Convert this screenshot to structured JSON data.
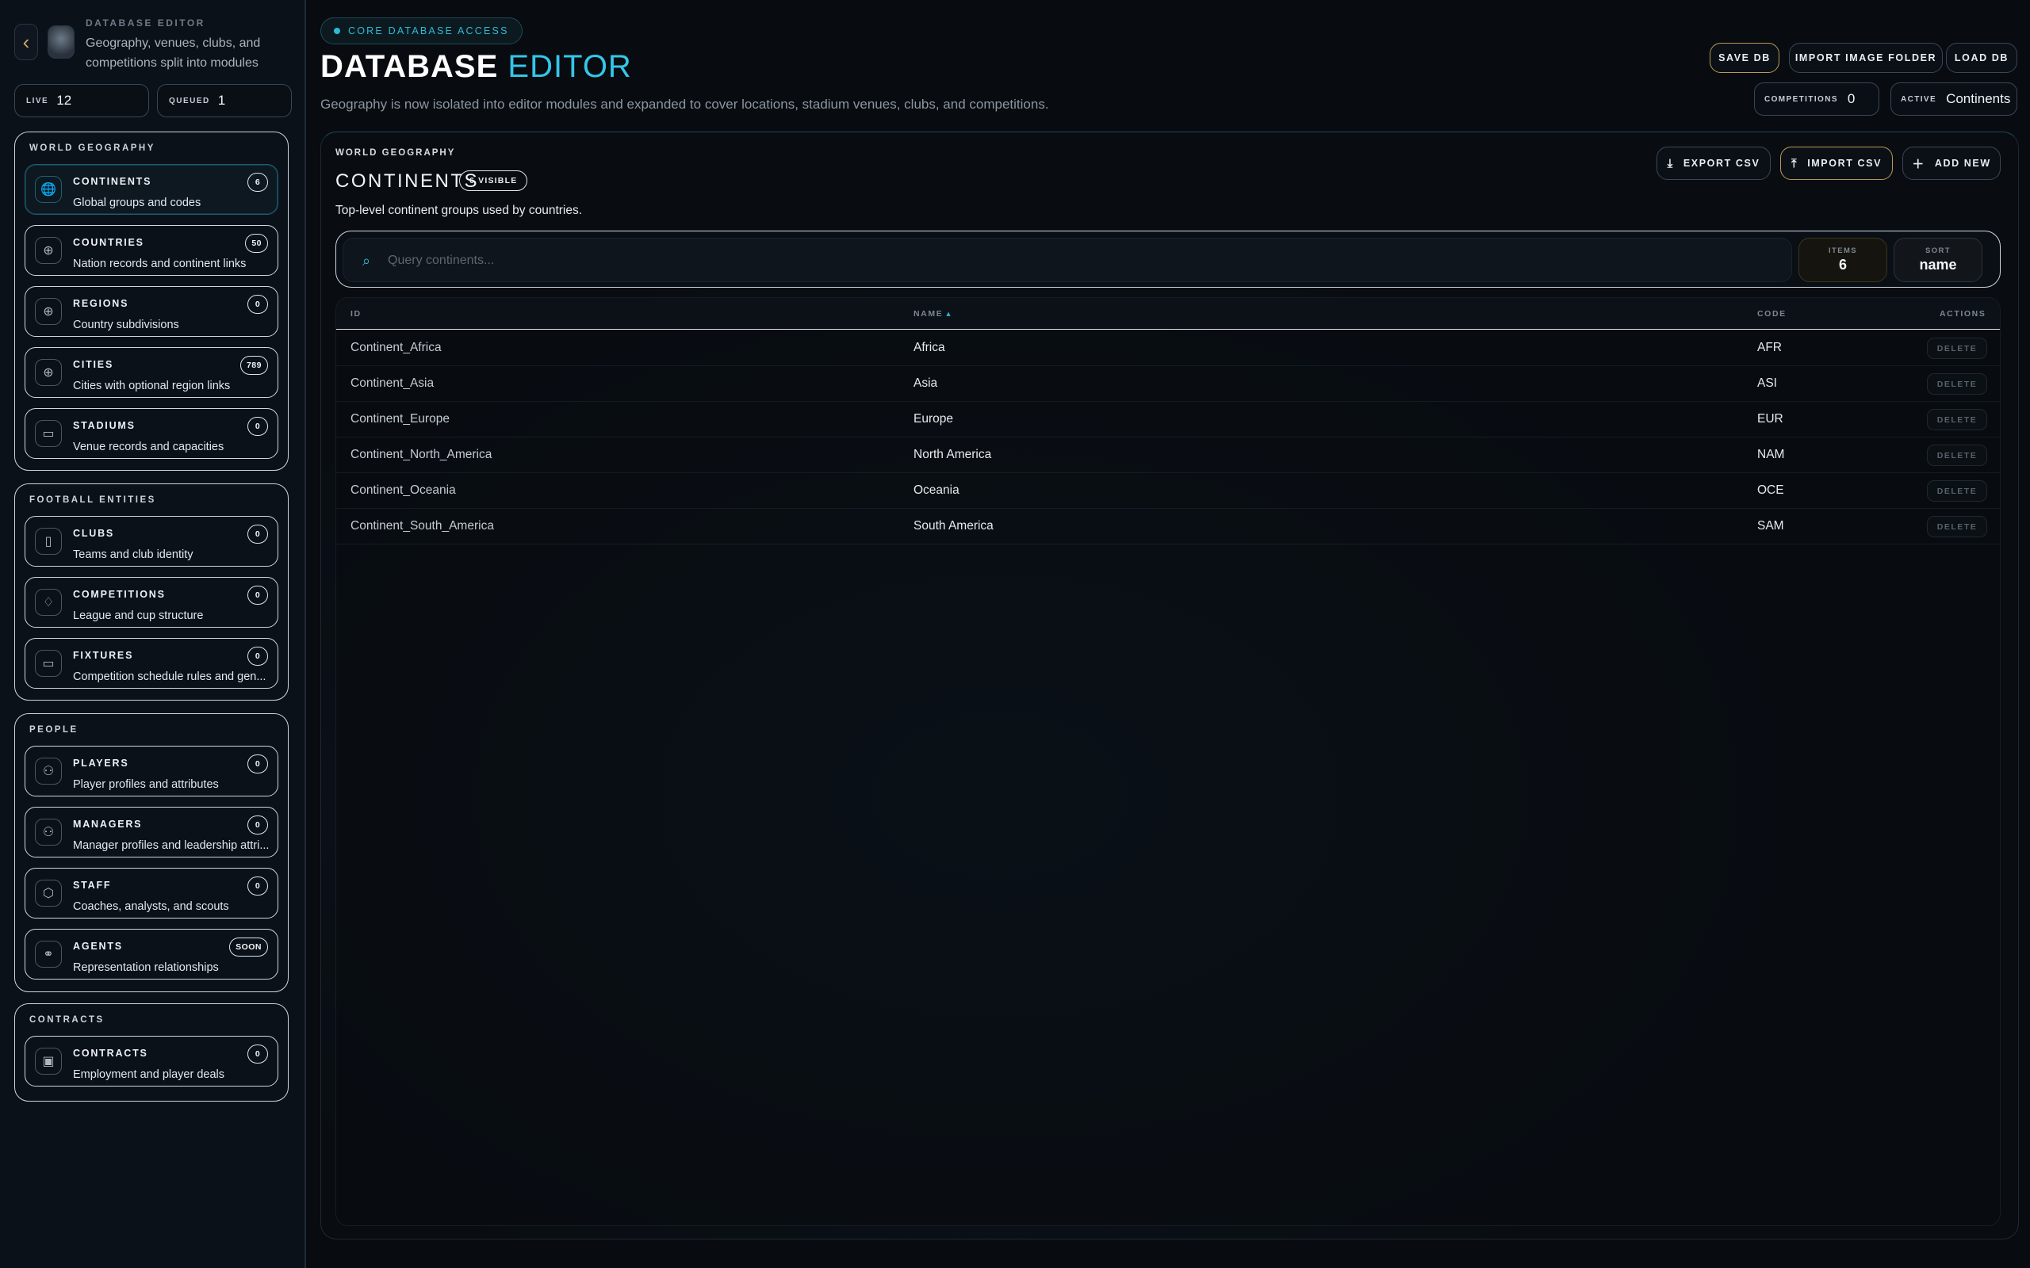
{
  "sidebar": {
    "eyebrow": "DATABASE EDITOR",
    "description": "Geography, venues, clubs, and competitions split into modules",
    "live": {
      "label": "LIVE",
      "value": "12"
    },
    "queued": {
      "label": "QUEUED",
      "value": "1"
    },
    "groups": [
      {
        "title": "WORLD GEOGRAPHY",
        "items": [
          {
            "name": "CONTINENTS",
            "sub": "Global groups and codes",
            "badge": "6",
            "icon": "globe-icon"
          },
          {
            "name": "COUNTRIES",
            "sub": "Nation records and continent links",
            "badge": "50",
            "icon": "globe-icon"
          },
          {
            "name": "REGIONS",
            "sub": "Country subdivisions",
            "badge": "0",
            "icon": "globe-icon"
          },
          {
            "name": "CITIES",
            "sub": "Cities with optional region links",
            "badge": "789",
            "icon": "globe-icon"
          },
          {
            "name": "STADIUMS",
            "sub": "Venue records and capacities",
            "badge": "0",
            "icon": "stadium-icon"
          }
        ]
      },
      {
        "title": "FOOTBALL ENTITIES",
        "items": [
          {
            "name": "CLUBS",
            "sub": "Teams and club identity",
            "badge": "0",
            "icon": "bookmark-icon"
          },
          {
            "name": "COMPETITIONS",
            "sub": "League and cup structure",
            "badge": "0",
            "icon": "trophy-icon"
          },
          {
            "name": "FIXTURES",
            "sub": "Competition schedule rules and gen...",
            "badge": "0",
            "icon": "calendar-icon"
          }
        ]
      },
      {
        "title": "PEOPLE",
        "items": [
          {
            "name": "PLAYERS",
            "sub": "Player profiles and attributes",
            "badge": "0",
            "icon": "user-icon"
          },
          {
            "name": "MANAGERS",
            "sub": "Manager profiles and leadership attri...",
            "badge": "0",
            "icon": "user-manager-icon"
          },
          {
            "name": "STAFF",
            "sub": "Coaches, analysts, and scouts",
            "badge": "0",
            "icon": "shield-icon"
          },
          {
            "name": "AGENTS",
            "sub": "Representation relationships",
            "badge": "SOON",
            "icon": "handshake-icon"
          }
        ]
      },
      {
        "title": "CONTRACTS",
        "items": [
          {
            "name": "CONTRACTS",
            "sub": "Employment and player deals",
            "badge": "0",
            "icon": "briefcase-icon"
          }
        ]
      }
    ]
  },
  "header": {
    "core_access": "CORE DATABASE ACCESS",
    "title_main": "DATABASE",
    "title_accent": "EDITOR",
    "subtitle": "Geography is now isolated into editor modules and expanded to cover locations, stadium venues, clubs, and competitions.",
    "buttons": {
      "save": "SAVE DB",
      "import_folder": "IMPORT IMAGE FOLDER",
      "load": "LOAD DB"
    },
    "competitions": {
      "label": "COMPETITIONS",
      "value": "0"
    },
    "active": {
      "label": "ACTIVE",
      "value": "Continents"
    }
  },
  "panel": {
    "eyebrow": "WORLD GEOGRAPHY",
    "title": "CONTINENTS",
    "visible_badge": "6 VISIBLE",
    "description": "Top-level continent groups used by countries.",
    "buttons": {
      "export": "EXPORT CSV",
      "import": "IMPORT CSV",
      "add": "ADD NEW"
    },
    "search_placeholder": "Query continents...",
    "items_stat": {
      "label": "ITEMS",
      "value": "6"
    },
    "sort_stat": {
      "label": "SORT",
      "value": "name"
    },
    "columns": {
      "id": "ID",
      "name": "NAME",
      "code": "CODE",
      "actions": "ACTIONS"
    },
    "delete_label": "DELETE",
    "rows": [
      {
        "id": "Continent_Africa",
        "name": "Africa",
        "code": "AFR"
      },
      {
        "id": "Continent_Asia",
        "name": "Asia",
        "code": "ASI"
      },
      {
        "id": "Continent_Europe",
        "name": "Europe",
        "code": "EUR"
      },
      {
        "id": "Continent_North_America",
        "name": "North America",
        "code": "NAM"
      },
      {
        "id": "Continent_Oceania",
        "name": "Oceania",
        "code": "OCE"
      },
      {
        "id": "Continent_South_America",
        "name": "South America",
        "code": "SAM"
      }
    ]
  },
  "colors": {
    "accent": "#34c6e8",
    "gold": "#b89a55",
    "background": "#080b10"
  }
}
